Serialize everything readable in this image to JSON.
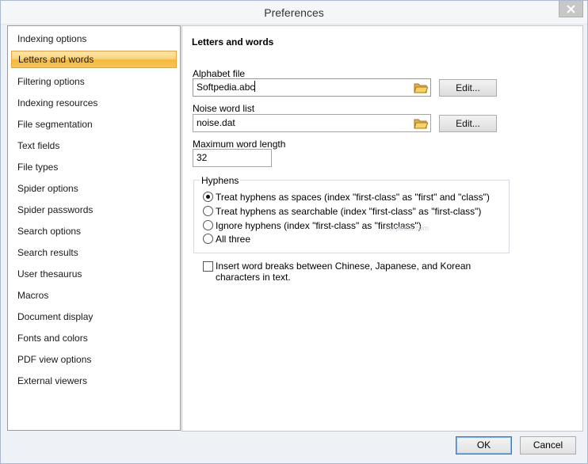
{
  "window": {
    "title": "Preferences"
  },
  "sidebar": {
    "items": [
      {
        "label": "Indexing options",
        "selected": false
      },
      {
        "label": "Letters and words",
        "selected": true
      },
      {
        "label": "Filtering options",
        "selected": false
      },
      {
        "label": "Indexing resources",
        "selected": false
      },
      {
        "label": "File segmentation",
        "selected": false
      },
      {
        "label": "Text fields",
        "selected": false
      },
      {
        "label": "File types",
        "selected": false
      },
      {
        "label": "Spider options",
        "selected": false
      },
      {
        "label": "Spider passwords",
        "selected": false
      },
      {
        "label": "Search options",
        "selected": false
      },
      {
        "label": "Search results",
        "selected": false
      },
      {
        "label": "User thesaurus",
        "selected": false
      },
      {
        "label": "Macros",
        "selected": false
      },
      {
        "label": "Document display",
        "selected": false
      },
      {
        "label": "Fonts and colors",
        "selected": false
      },
      {
        "label": "PDF view options",
        "selected": false
      },
      {
        "label": "External viewers",
        "selected": false
      }
    ]
  },
  "panel": {
    "title": "Letters and words",
    "alphabet": {
      "label": "Alphabet file",
      "value": "Softpedia.abc",
      "button": "Edit..."
    },
    "noise": {
      "label": "Noise word list",
      "value": "noise.dat",
      "button": "Edit..."
    },
    "max_length": {
      "label": "Maximum word length",
      "value": "32"
    },
    "hyphens": {
      "label": "Hyphens",
      "options": [
        {
          "label": "Treat hyphens as spaces (index \"first-class\" as \"first\" and \"class\")",
          "checked": true
        },
        {
          "label": "Treat hyphens as searchable (index \"first-class\" as \"first-class\")",
          "checked": false
        },
        {
          "label": "Ignore hyphens (index \"first-class\" as \"firstclass\")",
          "checked": false
        },
        {
          "label": "All three",
          "checked": false
        }
      ]
    },
    "word_breaks": {
      "label": "Insert word breaks between Chinese, Japanese, and Korean characters in text.",
      "checked": false
    },
    "watermark": "softpedia.com"
  },
  "footer": {
    "ok_label": "OK",
    "cancel_label": "Cancel"
  },
  "colors": {
    "selection_highlight": "#f6b83c",
    "focus_border": "#7a9cc6",
    "folder_icon": "#e8b23a"
  }
}
